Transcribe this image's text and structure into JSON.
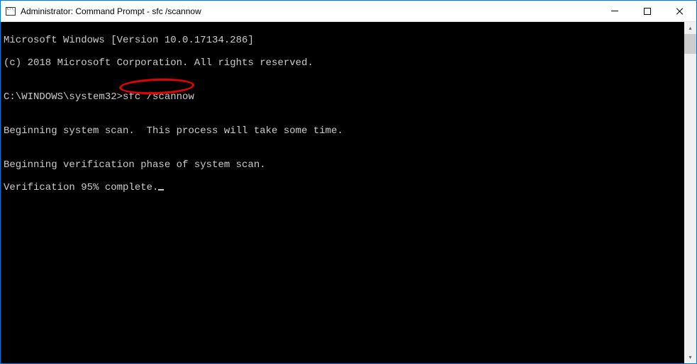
{
  "titlebar": {
    "title": "Administrator: Command Prompt - sfc  /scannow"
  },
  "console": {
    "line1": "Microsoft Windows [Version 10.0.17134.286]",
    "line2": "(c) 2018 Microsoft Corporation. All rights reserved.",
    "blank1": "",
    "prompt": "C:\\WINDOWS\\system32>",
    "command": "sfc /scannow",
    "blank2": "",
    "line3": "Beginning system scan.  This process will take some time.",
    "blank3": "",
    "line4": "Beginning verification phase of system scan.",
    "line5": "Verification 95% complete."
  },
  "annotation": {
    "circled_text": "sfc /scannow",
    "circle_color": "#e60000"
  }
}
